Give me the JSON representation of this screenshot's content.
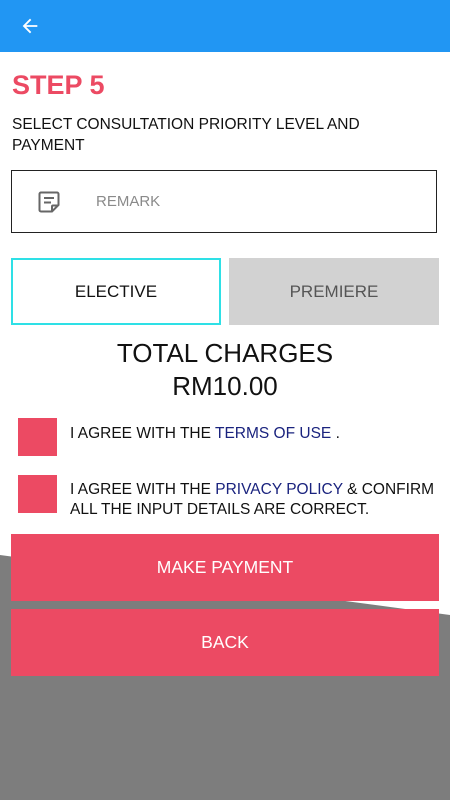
{
  "colors": {
    "appbar": "#2196f3",
    "accent": "#ec4a63",
    "selected_border": "#2ee0e6",
    "inactive_option": "#d2d2d2",
    "link": "#1a237e"
  },
  "appbar": {
    "back_icon": "arrow-left-icon"
  },
  "step": {
    "title": "STEP 5",
    "subtitle": "SELECT CONSULTATION PRIORITY LEVEL AND PAYMENT"
  },
  "remark": {
    "icon": "note-icon",
    "placeholder": "REMARK",
    "value": ""
  },
  "priority": {
    "selected": "ELECTIVE",
    "options": [
      "ELECTIVE",
      "PREMIERE"
    ]
  },
  "total": {
    "label": "TOTAL CHARGES",
    "amount": "RM10.00"
  },
  "agreements": {
    "terms": {
      "prefix": "I AGREE WITH THE",
      "link": "TERMS OF USE",
      "suffix": ".",
      "checked": false
    },
    "privacy": {
      "prefix": "I AGREE WITH THE",
      "link": "PRIVACY POLICY",
      "suffix": "& CONFIRM ALL THE INPUT DETAILS ARE CORRECT.",
      "checked": false
    }
  },
  "buttons": {
    "make_payment": "MAKE PAYMENT",
    "back": "BACK"
  }
}
